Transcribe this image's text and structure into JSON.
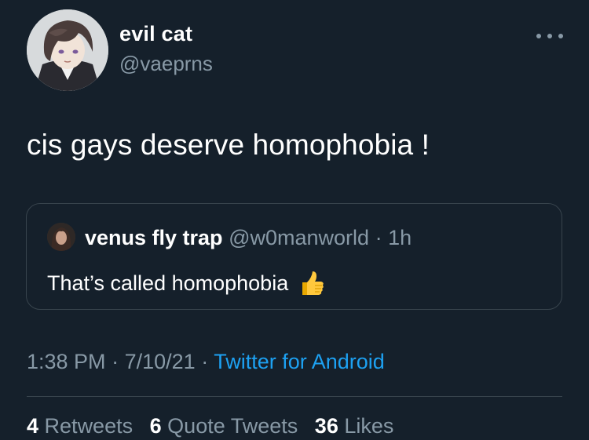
{
  "author": {
    "display_name": "evil cat",
    "handle": "@vaeprns",
    "avatar_icon": "anime-character-avatar"
  },
  "tweet": {
    "text": "cis gays deserve homophobia !"
  },
  "quoted_tweet": {
    "display_name": "venus fly trap",
    "handle": "@w0manworld",
    "separator": "·",
    "time": "1h",
    "text": "That’s called homophobia",
    "emoji_icon": "thumbs-up-icon"
  },
  "meta": {
    "time": "1:38 PM",
    "date": "7/10/21",
    "separator": "·",
    "source": "Twitter for Android"
  },
  "stats": {
    "retweets_count": "4",
    "retweets_label": "Retweets",
    "quote_count": "6",
    "quote_label": "Quote Tweets",
    "likes_count": "36",
    "likes_label": "Likes"
  },
  "colors": {
    "background": "#15202b",
    "primary_text": "#ffffff",
    "secondary_text": "#8899a6",
    "link": "#1da1f2",
    "border": "#38444d"
  }
}
